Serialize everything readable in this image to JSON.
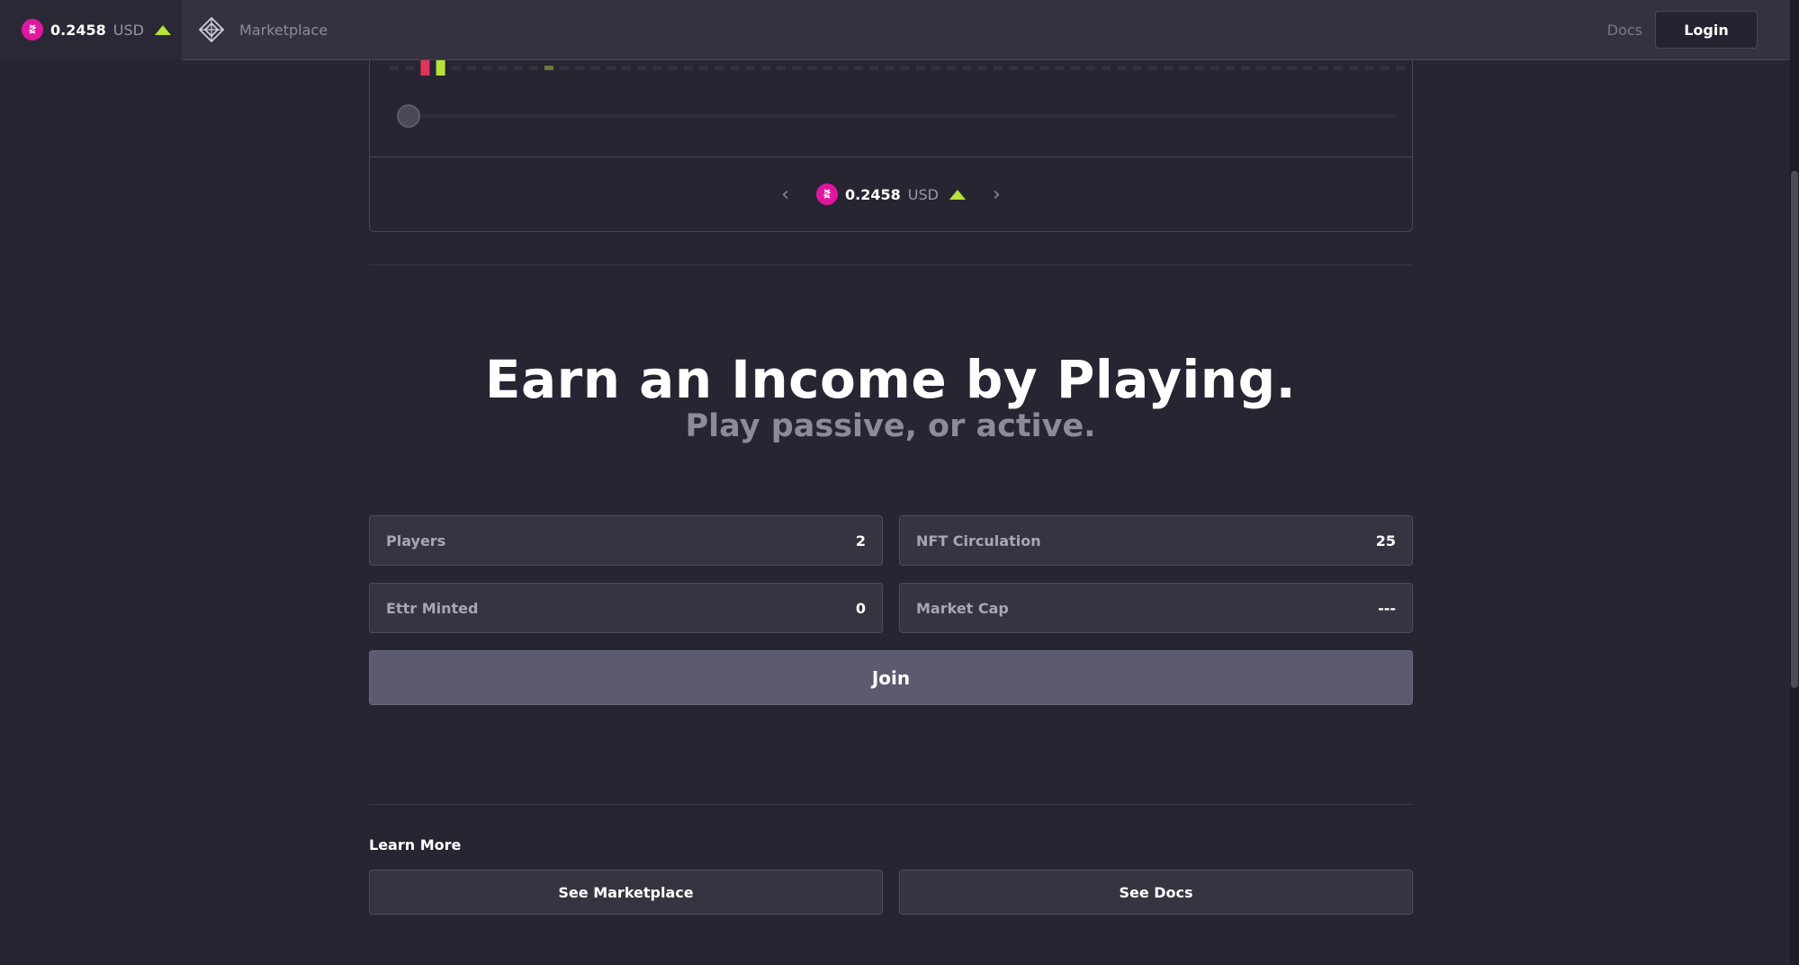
{
  "header": {
    "price_value": "0.2458",
    "price_currency": "USD",
    "marketplace_label": "Marketplace",
    "docs_label": "Docs",
    "login_label": "Login"
  },
  "pager": {
    "price_value": "0.2458",
    "price_currency": "USD"
  },
  "hero": {
    "title": "Earn an Income by Playing.",
    "subtitle": "Play passive, or active."
  },
  "stats": [
    {
      "label": "Players",
      "value": "2"
    },
    {
      "label": "NFT Circulation",
      "value": "25"
    },
    {
      "label": "Ettr Minted",
      "value": "0"
    },
    {
      "label": "Market Cap",
      "value": "---"
    }
  ],
  "join_label": "Join",
  "learn_more": {
    "title": "Learn More",
    "marketplace_button": "See Marketplace",
    "docs_button": "See Docs"
  },
  "colors": {
    "accent": "#e0179e",
    "up": "#b6e23a",
    "down": "#e0345a",
    "background": "#272532"
  },
  "chart_data": {
    "type": "bar",
    "bar_count": 66,
    "highlighted": [
      {
        "index": 2,
        "color": "#e0345a"
      },
      {
        "index": 3,
        "color": "#b6e23a"
      }
    ]
  }
}
